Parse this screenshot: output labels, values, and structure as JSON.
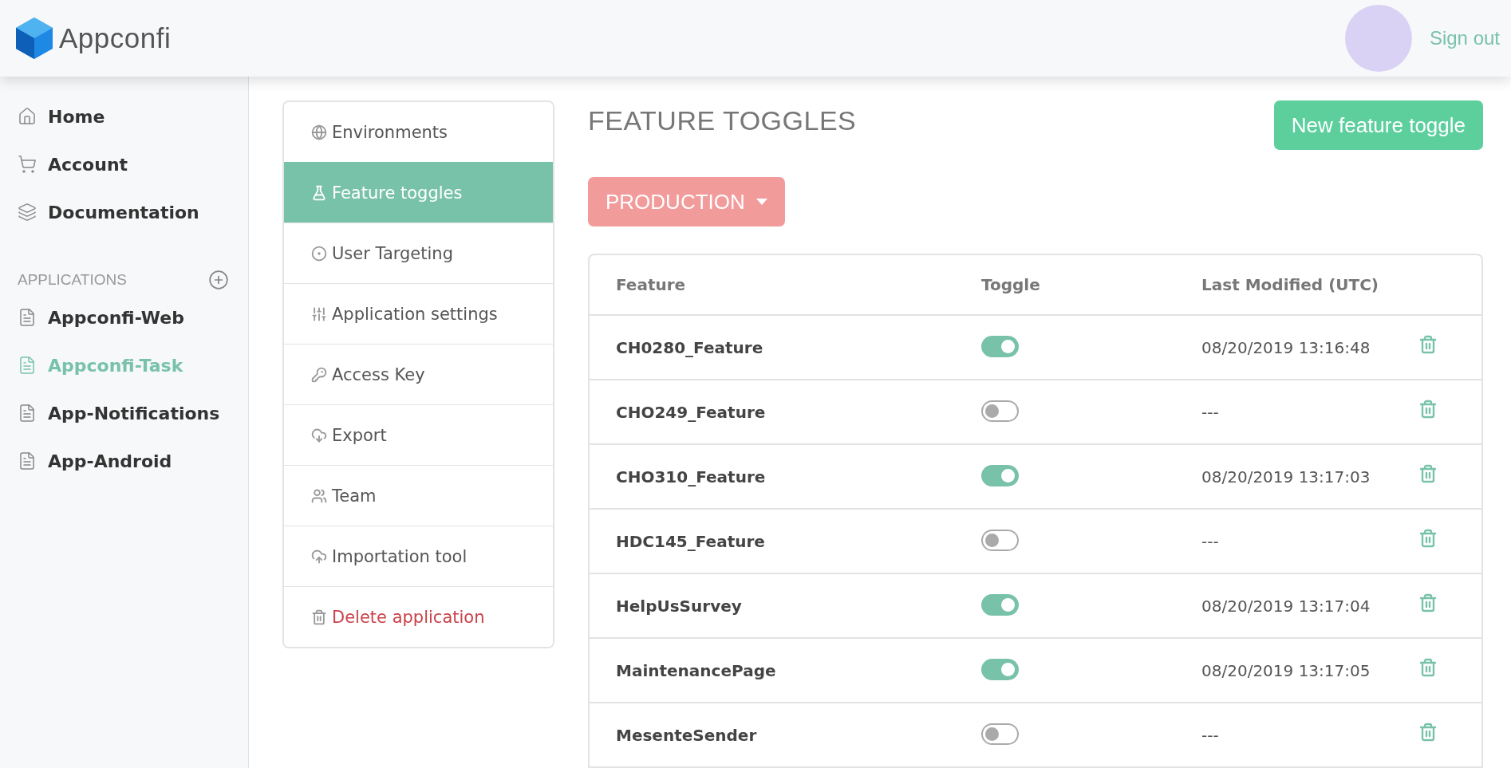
{
  "header": {
    "logo_text": "Appconfi",
    "sign_out": "Sign out"
  },
  "sidebar": {
    "nav": [
      {
        "label": "Home"
      },
      {
        "label": "Account"
      },
      {
        "label": "Documentation"
      }
    ],
    "applications_heading": "APPLICATIONS",
    "applications": [
      {
        "label": "Appconfi-Web",
        "selected": false
      },
      {
        "label": "Appconfi-Task",
        "selected": true
      },
      {
        "label": "App-Notifications",
        "selected": false
      },
      {
        "label": "App-Android",
        "selected": false
      }
    ]
  },
  "submenu": [
    {
      "label": "Environments",
      "selected": false,
      "kind": "normal"
    },
    {
      "label": "Feature toggles",
      "selected": true,
      "kind": "normal"
    },
    {
      "label": "User Targeting",
      "selected": false,
      "kind": "normal"
    },
    {
      "label": "Application settings",
      "selected": false,
      "kind": "normal"
    },
    {
      "label": "Access Key",
      "selected": false,
      "kind": "normal"
    },
    {
      "label": "Export",
      "selected": false,
      "kind": "normal"
    },
    {
      "label": "Team",
      "selected": false,
      "kind": "normal"
    },
    {
      "label": "Importation tool",
      "selected": false,
      "kind": "normal"
    },
    {
      "label": "Delete application",
      "selected": false,
      "kind": "danger"
    }
  ],
  "main": {
    "title": "FEATURE TOGGLES",
    "new_button": "New feature toggle",
    "environment": "PRODUCTION"
  },
  "table": {
    "columns": [
      "Feature",
      "Toggle",
      "Last Modified (UTC)"
    ],
    "rows": [
      {
        "feature": "CH0280_Feature",
        "on": true,
        "modified": "08/20/2019 13:16:48"
      },
      {
        "feature": "CHO249_Feature",
        "on": false,
        "modified": "---"
      },
      {
        "feature": "CHO310_Feature",
        "on": true,
        "modified": "08/20/2019 13:17:03"
      },
      {
        "feature": "HDC145_Feature",
        "on": false,
        "modified": "---"
      },
      {
        "feature": "HelpUsSurvey",
        "on": true,
        "modified": "08/20/2019 13:17:04"
      },
      {
        "feature": "MaintenancePage",
        "on": true,
        "modified": "08/20/2019 13:17:05"
      },
      {
        "feature": "MesenteSender",
        "on": false,
        "modified": "---"
      }
    ]
  }
}
